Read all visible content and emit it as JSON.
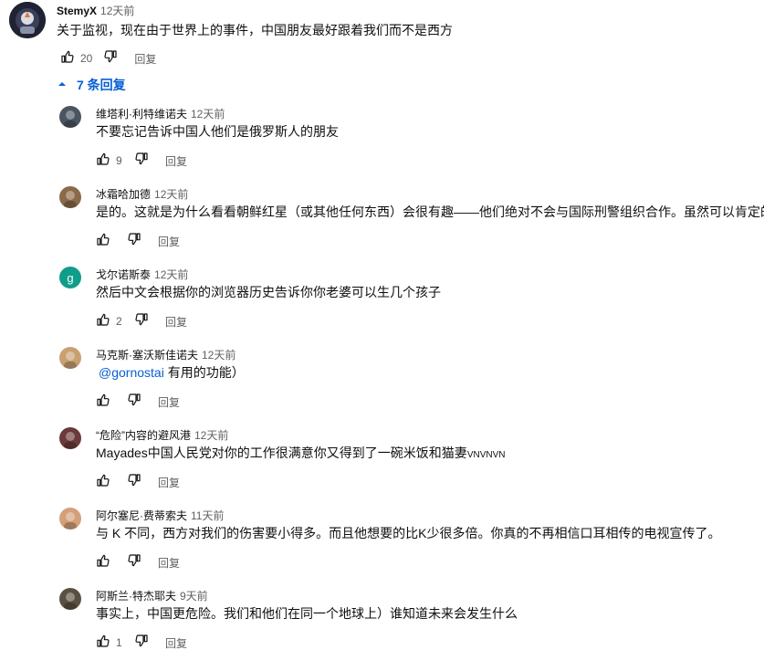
{
  "top_comment": {
    "author": "StemyX",
    "time": "12天前",
    "text": "关于监视，现在由于世界上的事件，中国朋友最好跟着我们而不是西方",
    "likes": "20",
    "reply_label": "回复"
  },
  "replies_toggle": {
    "label": "7 条回复"
  },
  "replies": [
    {
      "author": "维塔利·利特维诺夫",
      "time": "12天前",
      "text": "不要忘记告诉中国人他们是俄罗斯人的朋友",
      "likes": "9",
      "reply_label": "回复",
      "avatar_color": "#4a5560"
    },
    {
      "author": "冰霜哈加德",
      "time": "12天前",
      "text": "是的。这就是为什么看看朝鲜红星（或其他任何东西）会很有趣——他们绝对不会与国际刑警组织合作。虽然可以肯定的",
      "likes": "",
      "reply_label": "回复",
      "avatar_color": "#8a6a48"
    },
    {
      "author": "戈尔诺斯泰",
      "time": "12天前",
      "text": "然后中文会根据你的浏览器历史告诉你你老婆可以生几个孩子",
      "likes": "2",
      "reply_label": "回复",
      "avatar_color": "#0f9d8a",
      "avatar_letter": "g"
    },
    {
      "author": "马克斯·塞沃斯佳诺夫",
      "time": "12天前",
      "mention": "@gornostai",
      "text": " 有用的功能）",
      "likes": "",
      "reply_label": "回复",
      "avatar_color": "#c9a071"
    },
    {
      "author": "“危险”内容的避风港",
      "time": "12天前",
      "text": "Mayades中国人民党对你的工作很满意你又得到了一碗米饭和猫妻",
      "text_suffix": "VNVNVN",
      "likes": "",
      "reply_label": "回复",
      "avatar_color": "#6b3a3a"
    },
    {
      "author": "阿尔塞尼·费蒂索夫",
      "time": "11天前",
      "text": "与 K 不同，西方对我们的伤害要小得多。而且他想要的比K少很多倍。你真的不再相信口耳相传的电视宣传了。",
      "likes": "",
      "reply_label": "回复",
      "avatar_color": "#d4a07a"
    },
    {
      "author": "阿斯兰·特杰耶夫",
      "time": "9天前",
      "text": "事实上，中国更危险。我们和他们在同一个地球上）谁知道未来会发生什么",
      "likes": "1",
      "reply_label": "回复",
      "avatar_color": "#5a5040"
    }
  ],
  "icons": {
    "like": "thumbs-up-icon",
    "dislike": "thumbs-down-icon",
    "collapse": "chevron-up-icon"
  },
  "colors": {
    "link": "#065fd4",
    "secondary_text": "#606060",
    "primary_text": "#0f0f0f"
  }
}
